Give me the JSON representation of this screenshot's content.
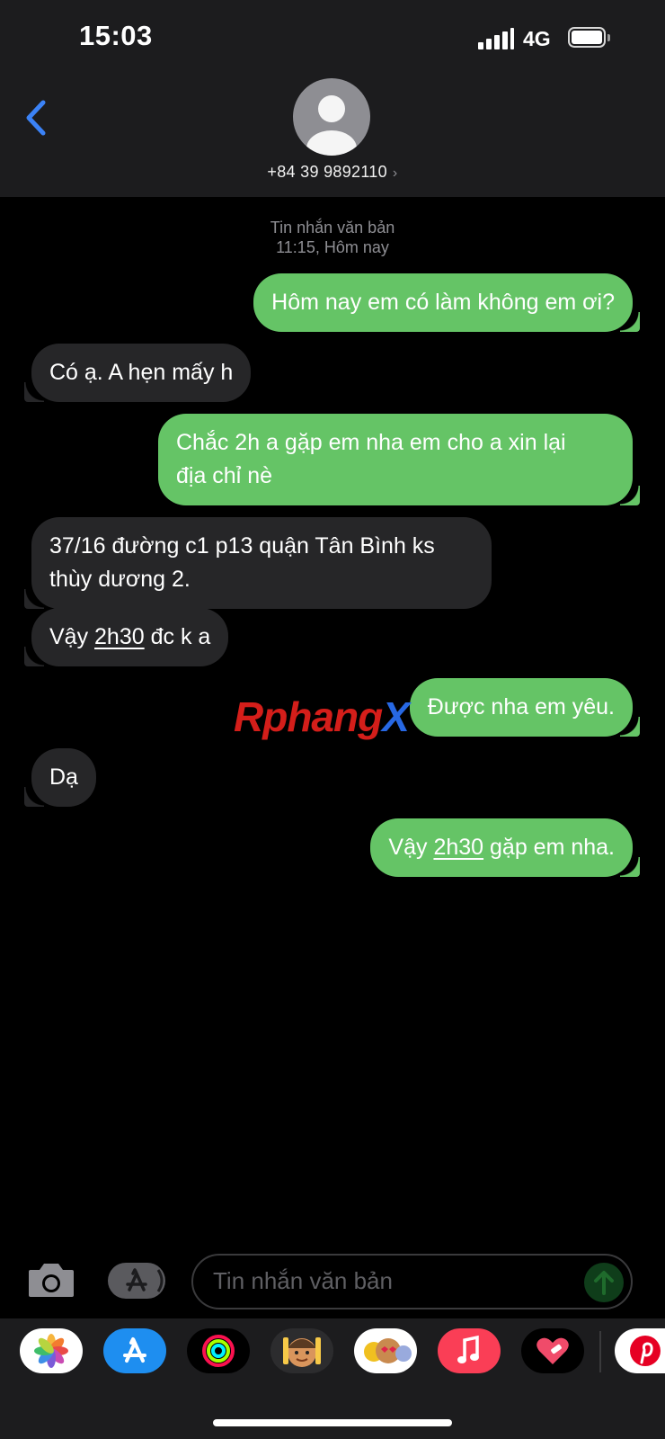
{
  "status": {
    "time": "15:03",
    "network": "4G"
  },
  "header": {
    "contact": "+84 39 9892110"
  },
  "thread": {
    "meta_type": "Tin nhắn văn bản",
    "meta_time": "11:15, Hôm nay",
    "messages": [
      {
        "from": "me",
        "text": "Hôm nay em có làm không em ơi?"
      },
      {
        "from": "them",
        "text": "Có ạ. A hẹn mấy h"
      },
      {
        "from": "me",
        "line1": "Chắc 2h a gặp em nha em cho a xin lại",
        "line2": "địa chỉ nè"
      },
      {
        "from": "them",
        "line1": "37/16 đường c1 p13 quận Tân Bình ks",
        "line2": "thùy dương 2."
      },
      {
        "from": "them",
        "pre": "Vậy ",
        "link": "2h30",
        "post": " đc k a"
      },
      {
        "from": "me",
        "text": "Được nha em yêu."
      },
      {
        "from": "them",
        "text": "Dạ"
      },
      {
        "from": "me",
        "pre": "Vậy ",
        "link": "2h30",
        "post": " gặp em nha."
      }
    ]
  },
  "watermark": {
    "part1": "Rphang",
    "part2": "X"
  },
  "composer": {
    "placeholder": "Tin nhắn văn bản"
  },
  "colors": {
    "outgoing": "#65c466",
    "incoming": "#262628",
    "accent": "#3b82f6"
  },
  "app_drawer": [
    "photos-icon",
    "app-store-icon",
    "activity-icon",
    "memoji-icon",
    "animoji-icon",
    "music-icon",
    "heart-app-icon",
    "pinterest-icon"
  ]
}
